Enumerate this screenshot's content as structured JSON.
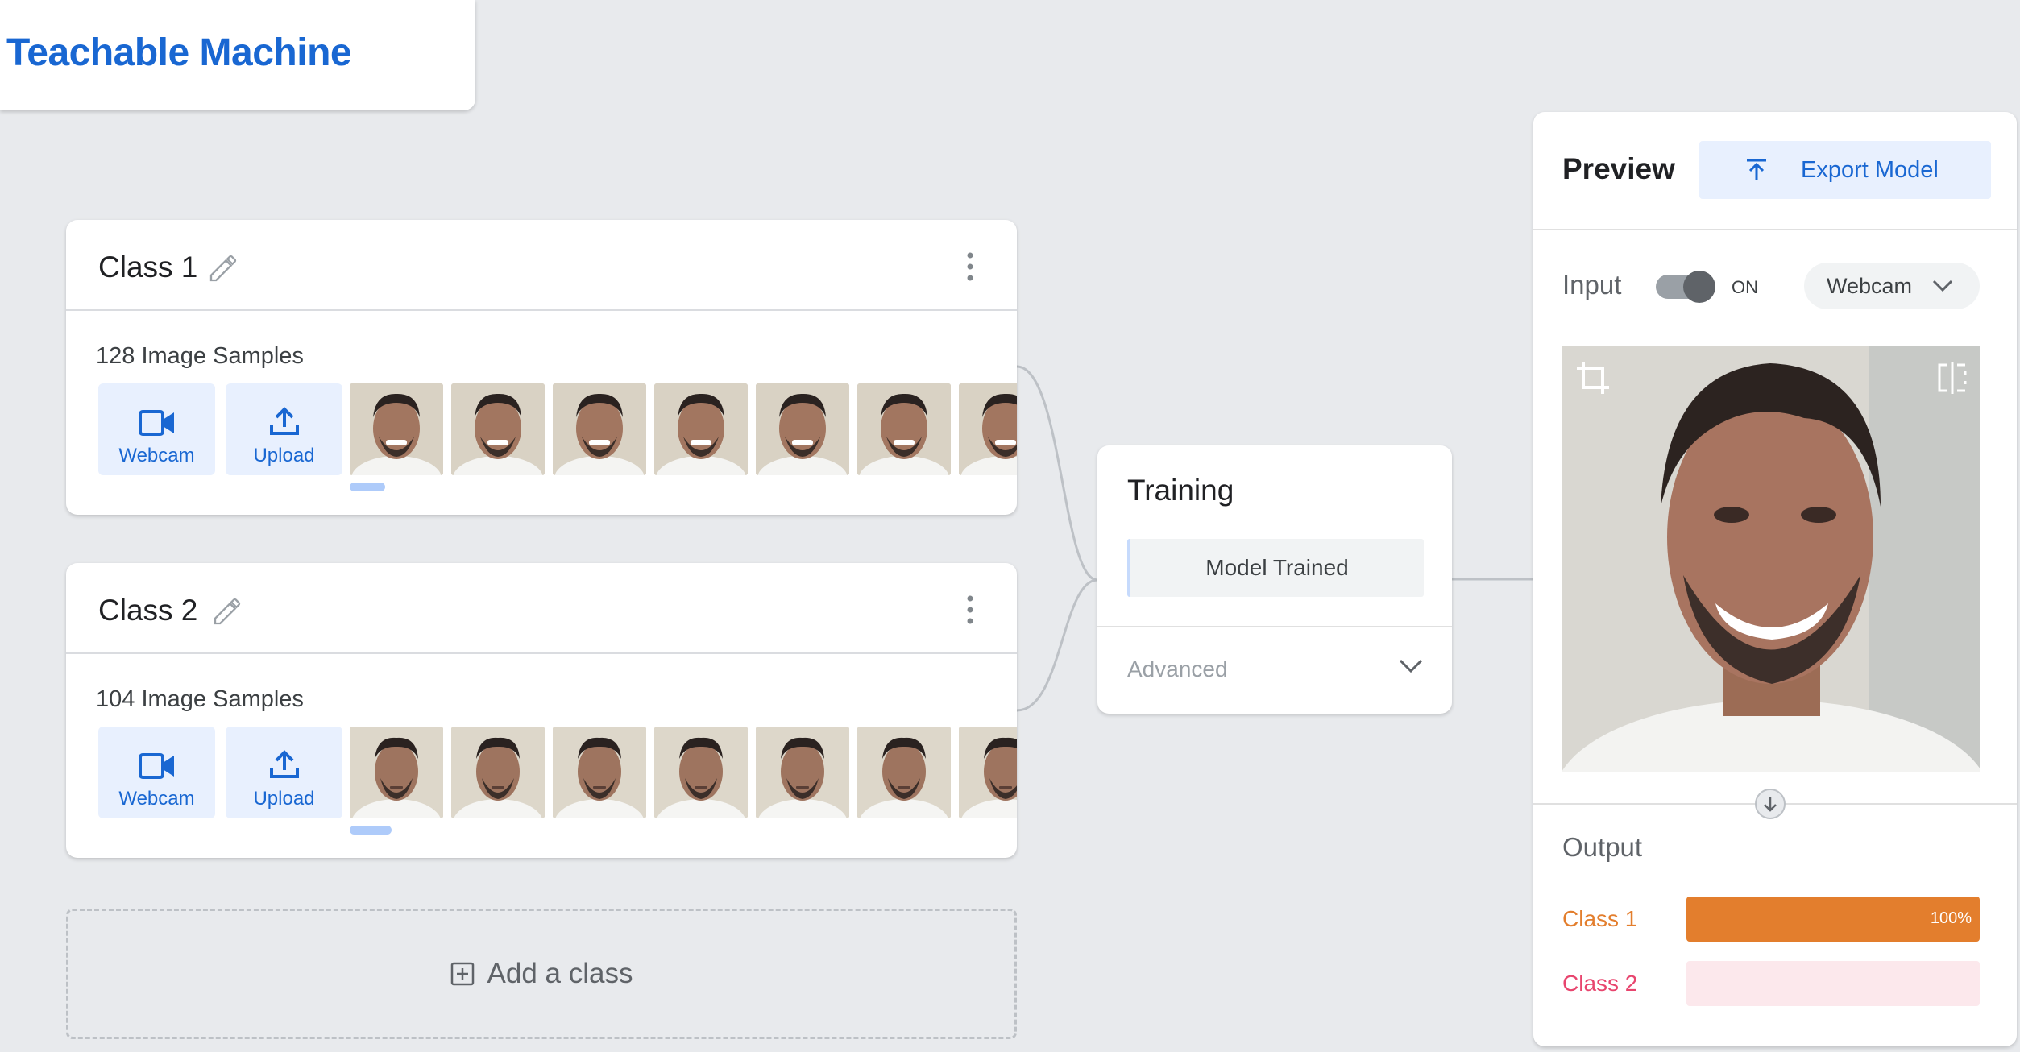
{
  "app": {
    "title": "Teachable Machine"
  },
  "classes": [
    {
      "name": "Class 1",
      "samples_label": "128 Image Samples",
      "webcam_label": "Webcam",
      "upload_label": "Upload"
    },
    {
      "name": "Class 2",
      "samples_label": "104 Image Samples",
      "webcam_label": "Webcam",
      "upload_label": "Upload"
    }
  ],
  "add_class": {
    "label": "Add a class"
  },
  "training": {
    "title": "Training",
    "button_label": "Model Trained",
    "advanced_label": "Advanced"
  },
  "preview": {
    "title": "Preview",
    "export_label": "Export Model",
    "input_label": "Input",
    "toggle_state": "ON",
    "input_source": "Webcam",
    "output_label": "Output",
    "outputs": [
      {
        "label": "Class 1",
        "value": 100,
        "value_text": "100%",
        "color": "#e37e2d",
        "track": "#fce8d5",
        "text_color": "#e37e2d"
      },
      {
        "label": "Class 2",
        "value": 0,
        "value_text": "",
        "color": "#e8456e",
        "track": "#fce8ec",
        "text_color": "#e8456e"
      }
    ]
  },
  "colors": {
    "accent": "#1967d2",
    "accent_light": "#e8f0fe",
    "background": "#e8eaed"
  },
  "icons": [
    "pencil-icon",
    "more-vert-icon",
    "webcam-icon",
    "upload-icon",
    "add-box-icon",
    "chevron-down-icon",
    "export-icon",
    "crop-icon",
    "flip-icon",
    "arrow-down-icon"
  ]
}
